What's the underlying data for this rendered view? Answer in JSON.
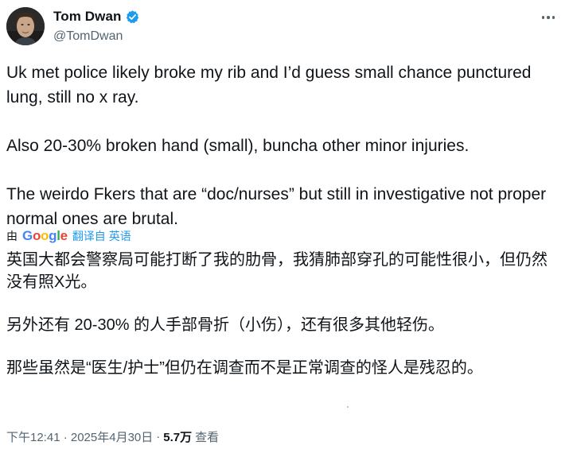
{
  "author": {
    "display_name": "Tom Dwan",
    "handle": "@TomDwan",
    "verified": true,
    "avatar_icon": "avatar-photo",
    "verified_color": "#1d9bf0"
  },
  "tweet": {
    "paragraphs": [
      "Uk met police likely broke my rib and I’d guess small chance punctured lung, still no x ray.",
      "Also 20-30% broken hand (small), buncha other minor injuries.",
      "The weirdo Fkers that are “doc/nurses” but still in investigative not proper normal ones are brutal."
    ]
  },
  "translation": {
    "by_label": "由",
    "provider": "Google",
    "link_label": "翻译自 英语",
    "paragraphs": [
      "英国大都会警察局可能打断了我的肋骨，我猜肺部穿孔的可能性很小，但仍然没有照X光。",
      "另外还有 20-30% 的人手部骨折（小伤），还有很多其他轻伤。",
      "那些虽然是“医生/护士”但仍在调查而不是正常调查的怪人是残忍的。"
    ]
  },
  "meta": {
    "timestamp": "下午12:41 · 2025年4月30日",
    "separator": "·",
    "views_count": "5.7万",
    "views_label": "查看"
  },
  "menu": {
    "icon": "more-icon"
  },
  "colors": {
    "text": "#0f1419",
    "secondary": "#536471",
    "link": "#1d9bf0"
  }
}
